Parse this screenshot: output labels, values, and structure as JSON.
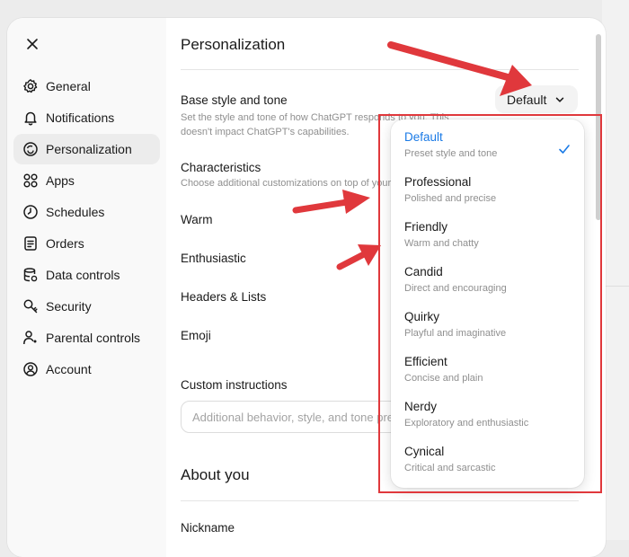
{
  "sidebar": {
    "items": [
      {
        "label": "General",
        "icon": "gear-icon"
      },
      {
        "label": "Notifications",
        "icon": "bell-icon"
      },
      {
        "label": "Personalization",
        "icon": "personalization-icon",
        "active": true
      },
      {
        "label": "Apps",
        "icon": "apps-grid-icon"
      },
      {
        "label": "Schedules",
        "icon": "clock-icon"
      },
      {
        "label": "Orders",
        "icon": "orders-icon"
      },
      {
        "label": "Data controls",
        "icon": "database-icon"
      },
      {
        "label": "Security",
        "icon": "security-icon"
      },
      {
        "label": "Parental controls",
        "icon": "parental-icon"
      },
      {
        "label": "Account",
        "icon": "account-icon"
      }
    ]
  },
  "main": {
    "title": "Personalization",
    "base_style": {
      "label": "Base style and tone",
      "description": "Set the style and tone of how ChatGPT responds to you. This doesn't impact ChatGPT's capabilities.",
      "value": "Default"
    },
    "characteristics": {
      "label": "Characteristics",
      "description": "Choose additional customizations on top of your base style and tone.",
      "items": [
        "Warm",
        "Enthusiastic",
        "Headers & Lists",
        "Emoji"
      ]
    },
    "custom_instructions": {
      "label": "Custom instructions",
      "placeholder": "Additional behavior, style, and tone preferences"
    },
    "about_you": {
      "title": "About you",
      "nickname_label": "Nickname"
    }
  },
  "dropdown": {
    "options": [
      {
        "label": "Default",
        "description": "Preset style and tone",
        "selected": true
      },
      {
        "label": "Professional",
        "description": "Polished and precise"
      },
      {
        "label": "Friendly",
        "description": "Warm and chatty"
      },
      {
        "label": "Candid",
        "description": "Direct and encouraging"
      },
      {
        "label": "Quirky",
        "description": "Playful and imaginative"
      },
      {
        "label": "Efficient",
        "description": "Concise and plain"
      },
      {
        "label": "Nerdy",
        "description": "Exploratory and enthusiastic"
      },
      {
        "label": "Cynical",
        "description": "Critical and sarcastic"
      }
    ]
  },
  "colors": {
    "accent": "#1a7ae6",
    "annotation": "#e0383c",
    "active_nav": "#ececec"
  }
}
